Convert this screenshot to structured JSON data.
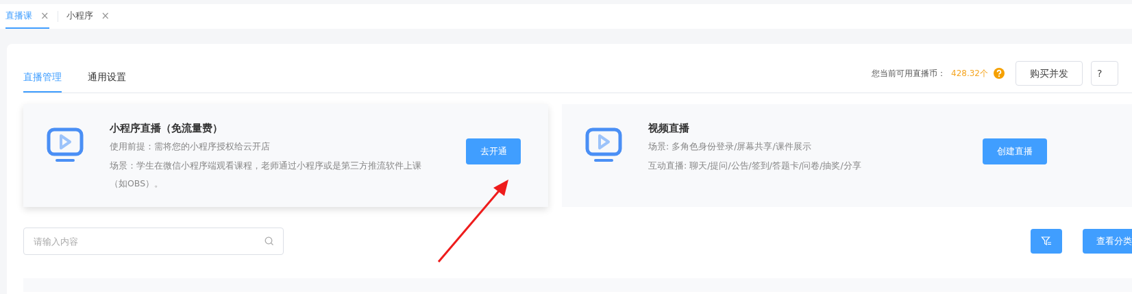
{
  "page_tabs": [
    {
      "label": "直播课",
      "close": "×",
      "selected": true
    },
    {
      "label": "小程序",
      "close": "×",
      "selected": false
    }
  ],
  "section_tabs": [
    {
      "label": "直播管理",
      "selected": true
    },
    {
      "label": "通用设置",
      "selected": false
    }
  ],
  "balance": {
    "label": "您当前可用直播币：",
    "value": "428.32个"
  },
  "header_buttons": [
    "购买并发",
    "?"
  ],
  "live_types": [
    {
      "title": "小程序直播（免流量费）",
      "lines": [
        "使用前提：需将您的小程序授权给云开店",
        "场景：学生在微信小程序端观看课程，老师通过小程序或是第三方推流软件上课（如OBS）。"
      ],
      "button": "去开通"
    },
    {
      "title": "视频直播",
      "lines": [
        "场景: 多角色身份登录/屏幕共享/课件展示",
        "互动直播: 聊天/提问/公告/签到/答题卡/问卷/抽奖/分享"
      ],
      "button": "创建直播"
    }
  ],
  "search": {
    "placeholder": "请输入内容"
  },
  "category_button": "查看分类"
}
